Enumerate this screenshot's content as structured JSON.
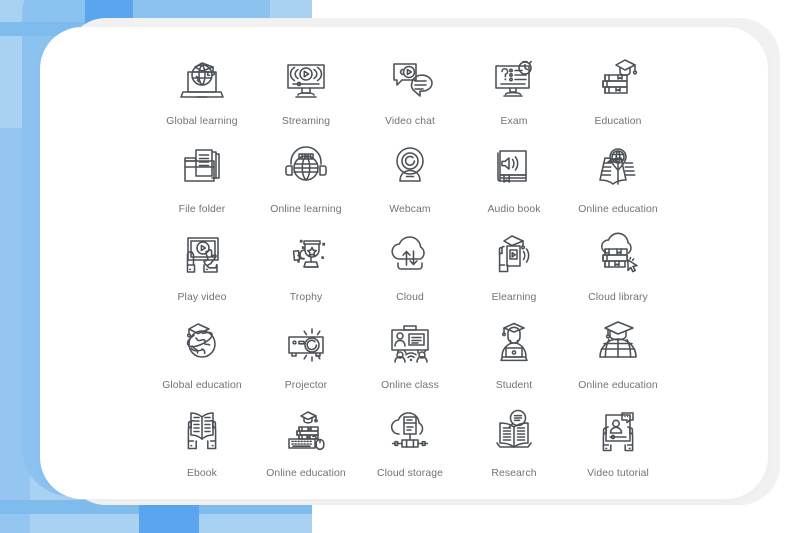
{
  "page": {
    "background_color": "#ffffff",
    "accent_blue": "#8cc2f0",
    "accent_blue_dark": "#5ba5ef",
    "accent_blue_pale": "#a9d1f2",
    "card_color": "#ffffff",
    "card_shadow_color": "#f1f1f2",
    "icon_stroke_color": "#4b5056",
    "label_color": "#6e7378"
  },
  "icon_set": {
    "columns": 5,
    "rows": 5,
    "count": 25,
    "items": [
      {
        "id": "global-learning",
        "label": "Global learning",
        "icon": "laptop-globe-graduation-cap-icon"
      },
      {
        "id": "streaming",
        "label": "Streaming",
        "icon": "monitor-play-signal-icon"
      },
      {
        "id": "video-chat",
        "label": "Video chat",
        "icon": "speech-bubble-play-icon"
      },
      {
        "id": "exam",
        "label": "Exam",
        "icon": "monitor-question-stopwatch-icon"
      },
      {
        "id": "education",
        "label": "Education",
        "icon": "books-graduation-cap-icon"
      },
      {
        "id": "file-folder",
        "label": "File folder",
        "icon": "folder-documents-icon"
      },
      {
        "id": "online-learning",
        "label": "Online learning",
        "icon": "globe-headphones-icon"
      },
      {
        "id": "webcam",
        "label": "Webcam",
        "icon": "webcam-lens-icon"
      },
      {
        "id": "audio-book",
        "label": "Audio book",
        "icon": "book-speaker-icon"
      },
      {
        "id": "online-education-1",
        "label": "Online education",
        "icon": "open-book-globe-pin-icon"
      },
      {
        "id": "play-video",
        "label": "Play video",
        "icon": "tablet-hands-play-icon"
      },
      {
        "id": "trophy",
        "label": "Trophy",
        "icon": "trophy-star-icon"
      },
      {
        "id": "cloud",
        "label": "Cloud",
        "icon": "cloud-upload-download-icon"
      },
      {
        "id": "elearning",
        "label": "Elearning",
        "icon": "hand-phone-graduation-cap-icon"
      },
      {
        "id": "cloud-library",
        "label": "Cloud library",
        "icon": "cloud-books-cursor-icon"
      },
      {
        "id": "global-education",
        "label": "Global education",
        "icon": "globe-orbit-graduation-cap-icon"
      },
      {
        "id": "projector",
        "label": "Projector",
        "icon": "projector-beam-icon"
      },
      {
        "id": "online-class",
        "label": "Online class",
        "icon": "whiteboard-teacher-wifi-icon"
      },
      {
        "id": "student",
        "label": "Student",
        "icon": "student-laptop-icon"
      },
      {
        "id": "online-education-2",
        "label": "Online education",
        "icon": "globe-grid-graduation-cap-icon"
      },
      {
        "id": "ebook",
        "label": "Ebook",
        "icon": "hands-open-book-icon"
      },
      {
        "id": "online-education-3",
        "label": "Online education",
        "icon": "keyboard-books-mouse-graduation-icon"
      },
      {
        "id": "cloud-storage",
        "label": "Cloud storage",
        "icon": "cloud-server-network-icon"
      },
      {
        "id": "research",
        "label": "Research",
        "icon": "open-book-magnifier-icon"
      },
      {
        "id": "video-tutorial",
        "label": "Video tutorial",
        "icon": "hands-tablet-video-chat-icon"
      }
    ]
  }
}
